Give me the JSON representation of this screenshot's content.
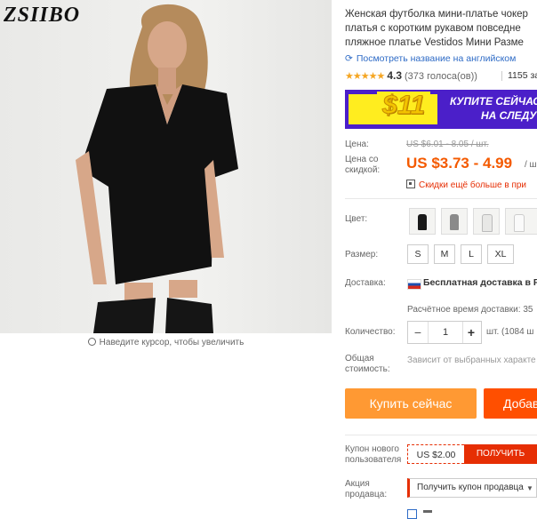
{
  "photo": {
    "brand": "ZSIIBO",
    "zoom_hint": "Наведите курсор, чтобы увеличить"
  },
  "product": {
    "title_lines": [
      "Женская футболка мини-платье чокер",
      "платья с коротким рукавом повседне",
      "пляжное платье Vestidos Мини Разме"
    ],
    "translate_link": "Посмотреть название на английском",
    "rating": {
      "stars": 4.3,
      "stars_display": "★★★★★",
      "score": "4.3",
      "votes": "(373 голоса(ов))",
      "orders": "1155 за"
    }
  },
  "banner": {
    "amount": "$11",
    "line1": "КУПИТЕ СЕЙЧАС",
    "line2": "НА СЛЕДУ"
  },
  "pricing": {
    "old_label": "Цена:",
    "old_price": "US $6.01 - 8.05 / шт.",
    "new_label": "Цена со скидкой:",
    "new_price": "US $3.73 - 4.99",
    "unit": "/ ш",
    "discount_text": "Скидки ещё больше в при"
  },
  "options": {
    "color_label": "Цвет:",
    "colors": [
      {
        "name": "black",
        "hex": "#1a1a1a"
      },
      {
        "name": "gray",
        "hex": "#8a8a8a"
      },
      {
        "name": "white",
        "hex": "#f0f0f0"
      },
      {
        "name": "white-2",
        "hex": "#fafafa"
      }
    ],
    "size_label": "Размер:",
    "sizes": [
      "S",
      "M",
      "L",
      "XL"
    ]
  },
  "shipping": {
    "label": "Доставка:",
    "text": "Бесплатная доставка в Russia",
    "time": "Расчётное время доставки: 35"
  },
  "quantity": {
    "label": "Количество:",
    "minus": "−",
    "value": "1",
    "plus": "+",
    "available": "шт. (1084 ш"
  },
  "total": {
    "label": "Общая стоимость:",
    "value": "Зависит от выбранных характе"
  },
  "actions": {
    "buy_now": "Купить сейчас",
    "add_to_cart": "Добав"
  },
  "coupon": {
    "label": "Купон нового пользователя",
    "amount": "US $2.00",
    "get": "ПОЛУЧИТЬ"
  },
  "promo": {
    "label": "Акция продавца:",
    "select_value": "Получить купон продавца",
    "caret": "▼"
  }
}
